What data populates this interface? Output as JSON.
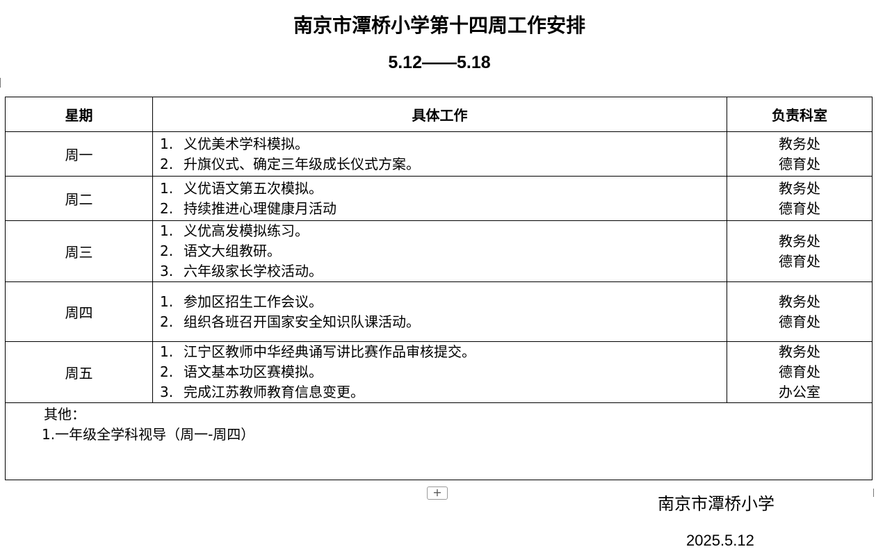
{
  "title": "南京市潭桥小学第十四周工作安排",
  "subtitle": "5.12——5.18",
  "table": {
    "headers": {
      "day": "星期",
      "work": "具体工作",
      "dept": "负责科室"
    },
    "rows": [
      {
        "day": "周一",
        "items": [
          {
            "n": "1.",
            "text": "义优美术学科模拟。"
          },
          {
            "n": "2.",
            "text": "升旗仪式、确定三年级成长仪式方案。"
          }
        ],
        "depts": [
          "教务处",
          "德育处"
        ]
      },
      {
        "day": "周二",
        "items": [
          {
            "n": "1.",
            "text": "义优语文第五次模拟。"
          },
          {
            "n": "2.",
            "text": "持续推进心理健康月活动"
          }
        ],
        "depts": [
          "教务处",
          "德育处"
        ]
      },
      {
        "day": "周三",
        "items": [
          {
            "n": "1.",
            "text": "义优高发模拟练习。"
          },
          {
            "n": "2.",
            "text": "语文大组教研。"
          },
          {
            "n": "3.",
            "text": "六年级家长学校活动。"
          }
        ],
        "depts": [
          "教务处",
          "德育处"
        ]
      },
      {
        "day": "周四",
        "items": [
          {
            "n": "1.",
            "text": "参加区招生工作会议。"
          },
          {
            "n": "2.",
            "text": "组织各班召开国家安全知识队课活动。"
          }
        ],
        "depts": [
          "教务处",
          "德育处"
        ]
      },
      {
        "day": "周五",
        "items": [
          {
            "n": "1.",
            "text": "江宁区教师中华经典诵写讲比赛作品审核提交。"
          },
          {
            "n": "2.",
            "text": "语文基本功区赛模拟。"
          },
          {
            "n": "3.",
            "text": "完成江苏教师教育信息变更。"
          }
        ],
        "depts": [
          "教务处",
          "德育处",
          "办公室"
        ]
      }
    ],
    "other": {
      "label": "其他：",
      "line": "1.一年级全学科视导（周一-周四）"
    }
  },
  "add_row_symbol": "+",
  "footer": {
    "school": "南京市潭桥小学",
    "date": "2025.5.12"
  }
}
